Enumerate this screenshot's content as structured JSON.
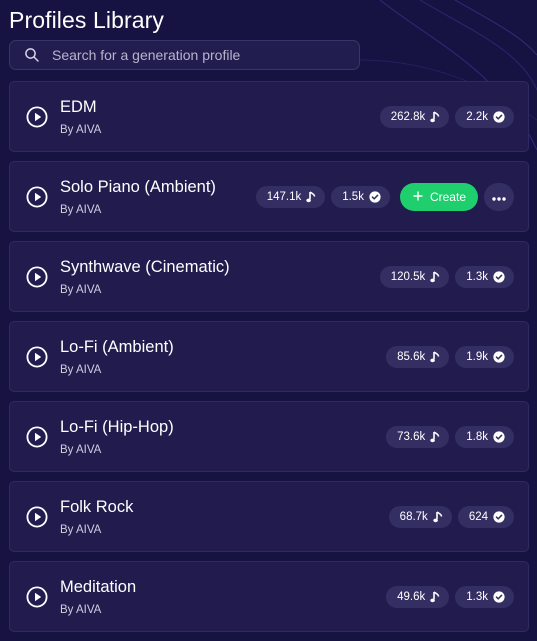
{
  "header": {
    "title": "Profiles Library"
  },
  "search": {
    "placeholder": "Search for a generation profile",
    "value": ""
  },
  "colors": {
    "background": "#161242",
    "card": "#211b4e",
    "pill": "#342f63",
    "create_button": "#1fce6d"
  },
  "profiles": [
    {
      "name": "EDM",
      "author": "By AIVA",
      "plays": "262.8k",
      "likes": "2.2k",
      "hovered": false
    },
    {
      "name": "Solo Piano (Ambient)",
      "author": "By AIVA",
      "plays": "147.1k",
      "likes": "1.5k",
      "hovered": true
    },
    {
      "name": "Synthwave (Cinematic)",
      "author": "By AIVA",
      "plays": "120.5k",
      "likes": "1.3k",
      "hovered": false
    },
    {
      "name": "Lo-Fi (Ambient)",
      "author": "By AIVA",
      "plays": "85.6k",
      "likes": "1.9k",
      "hovered": false
    },
    {
      "name": "Lo-Fi (Hip-Hop)",
      "author": "By AIVA",
      "plays": "73.6k",
      "likes": "1.8k",
      "hovered": false
    },
    {
      "name": "Folk Rock",
      "author": "By AIVA",
      "plays": "68.7k",
      "likes": "624",
      "hovered": false
    },
    {
      "name": "Meditation",
      "author": "By AIVA",
      "plays": "49.6k",
      "likes": "1.3k",
      "hovered": false
    }
  ],
  "actions": {
    "create_label": "Create"
  },
  "icons": {
    "play": "play-circle-icon",
    "plays": "music-note-icon",
    "likes": "check-circle-icon",
    "search": "search-icon",
    "create": "plus-icon",
    "more": "more-horizontal-icon"
  }
}
